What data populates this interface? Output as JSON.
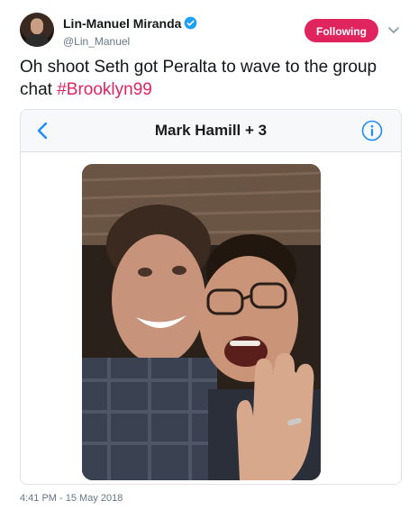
{
  "author": {
    "display_name": "Lin-Manuel Miranda",
    "handle": "@Lin_Manuel",
    "verified": true,
    "avatar_icon": "avatar-photo"
  },
  "follow_button": {
    "label": "Following",
    "color": "#e0245e"
  },
  "tweet": {
    "text": "Oh shoot Seth got Peralta to wave to the group chat ",
    "hashtag": "#Brooklyn99"
  },
  "media": {
    "chat_title": "Mark Hamill + 3",
    "back_icon": "chevron-left-icon",
    "info_icon": "info-circle-icon",
    "accent_color": "#1d8cf8"
  },
  "timestamp": "4:41 PM - 15 May 2018",
  "colors": {
    "text": "#14171a",
    "secondary": "#657786",
    "verified": "#1da1f2",
    "hashtag": "#e0245e"
  }
}
